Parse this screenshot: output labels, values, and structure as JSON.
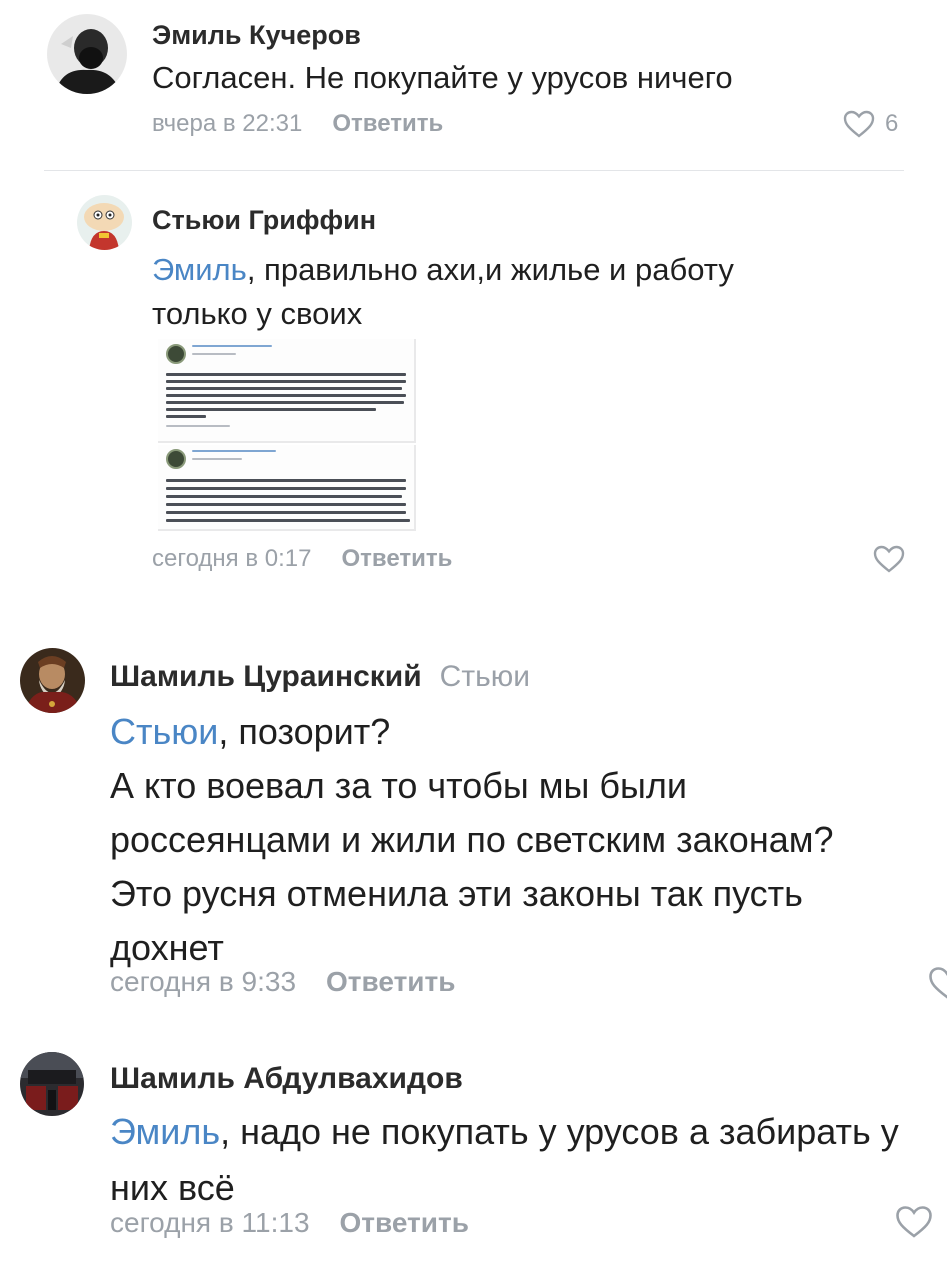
{
  "colors": {
    "mention": "#4a86c5",
    "meta": "#9ba1a8",
    "name": "#2b2b2b",
    "text": "#1f1f1f"
  },
  "comments": [
    {
      "author": "Эмиль Кучеров",
      "avatar_icon": "dark-bearded-man-avatar",
      "lines": [
        "Согласен. Не покупайте у урусов ничего"
      ],
      "time": "вчера в 22:31",
      "reply_label": "Ответить",
      "likes": "6"
    },
    {
      "author": "Стьюи Гриффин",
      "avatar_icon": "stewie-cartoon-avatar",
      "mention": "Эмиль",
      "lines": [
        ", правильно ахи,и жилье и работу",
        "только у своих"
      ],
      "time": "сегодня в 0:17",
      "reply_label": "Ответить",
      "attachment_icon": "screenshot-of-posts-image"
    },
    {
      "author": "Шамиль Цураинский",
      "reply_to": "Стьюи",
      "avatar_icon": "bearded-elder-portrait-avatar",
      "mention": "Стьюи",
      "lines": [
        ", позорит?",
        "А кто воевал за то чтобы мы были",
        "россеянцами и жили по светским законам?",
        "Это русня отменила эти законы так пусть",
        "дохнет"
      ],
      "time": "сегодня в 9:33",
      "reply_label": "Ответить"
    },
    {
      "author": "Шамиль Абдулвахидов",
      "avatar_icon": "car-interior-avatar",
      "mention": "Эмиль",
      "lines": [
        ", надо не покупать у урусов а забирать у",
        "них всё"
      ],
      "time": "сегодня в 11:13",
      "reply_label": "Ответить"
    }
  ]
}
